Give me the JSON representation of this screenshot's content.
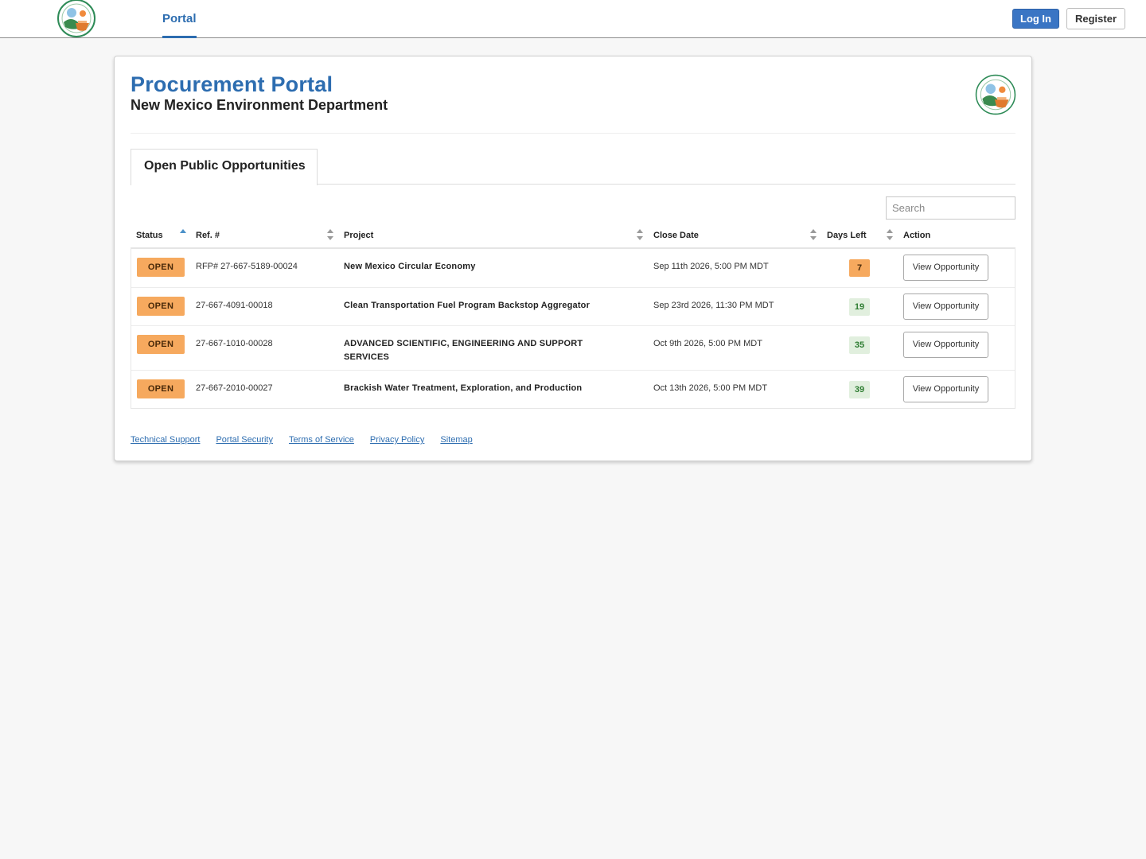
{
  "nav": {
    "portal_label": "Portal",
    "login_label": "Log In",
    "register_label": "Register"
  },
  "header": {
    "title": "Procurement Portal",
    "subtitle": "New Mexico Environment Department"
  },
  "tab": {
    "label": "Open Public Opportunities"
  },
  "search": {
    "placeholder": "Search"
  },
  "columns": {
    "status": "Status",
    "ref": "Ref. #",
    "project": "Project",
    "close_date": "Close Date",
    "days_left": "Days Left",
    "action": "Action"
  },
  "rows": [
    {
      "status": "OPEN",
      "ref": "RFP# 27-667-5189-00024",
      "project": "New Mexico Circular Economy",
      "close_date": "Sep 11th 2026, 5:00 PM MDT",
      "days_left": "7",
      "action": "View Opportunity"
    },
    {
      "status": "OPEN",
      "ref": "27-667-4091-00018",
      "project": "Clean Transportation Fuel Program Backstop Aggregator",
      "close_date": "Sep 23rd 2026, 11:30 PM MDT",
      "days_left": "19",
      "action": "View Opportunity"
    },
    {
      "status": "OPEN",
      "ref": "27-667-1010-00028",
      "project": "ADVANCED SCIENTIFIC, ENGINEERING AND SUPPORT SERVICES",
      "close_date": "Oct 9th 2026, 5:00 PM MDT",
      "days_left": "35",
      "action": "View Opportunity"
    },
    {
      "status": "OPEN",
      "ref": "27-667-2010-00027",
      "project": "Brackish Water Treatment, Exploration, and Production",
      "close_date": "Oct 13th 2026, 5:00 PM MDT",
      "days_left": "39",
      "action": "View Opportunity"
    }
  ],
  "footer": {
    "links": [
      "Technical Support",
      "Portal Security",
      "Terms of Service",
      "Privacy Policy",
      "Sitemap"
    ]
  },
  "colors": {
    "brand_blue": "#2d6db0",
    "open_badge": "#f6a95e",
    "days_ok_bg": "#e1efde",
    "days_ok_text": "#2e7d32"
  }
}
